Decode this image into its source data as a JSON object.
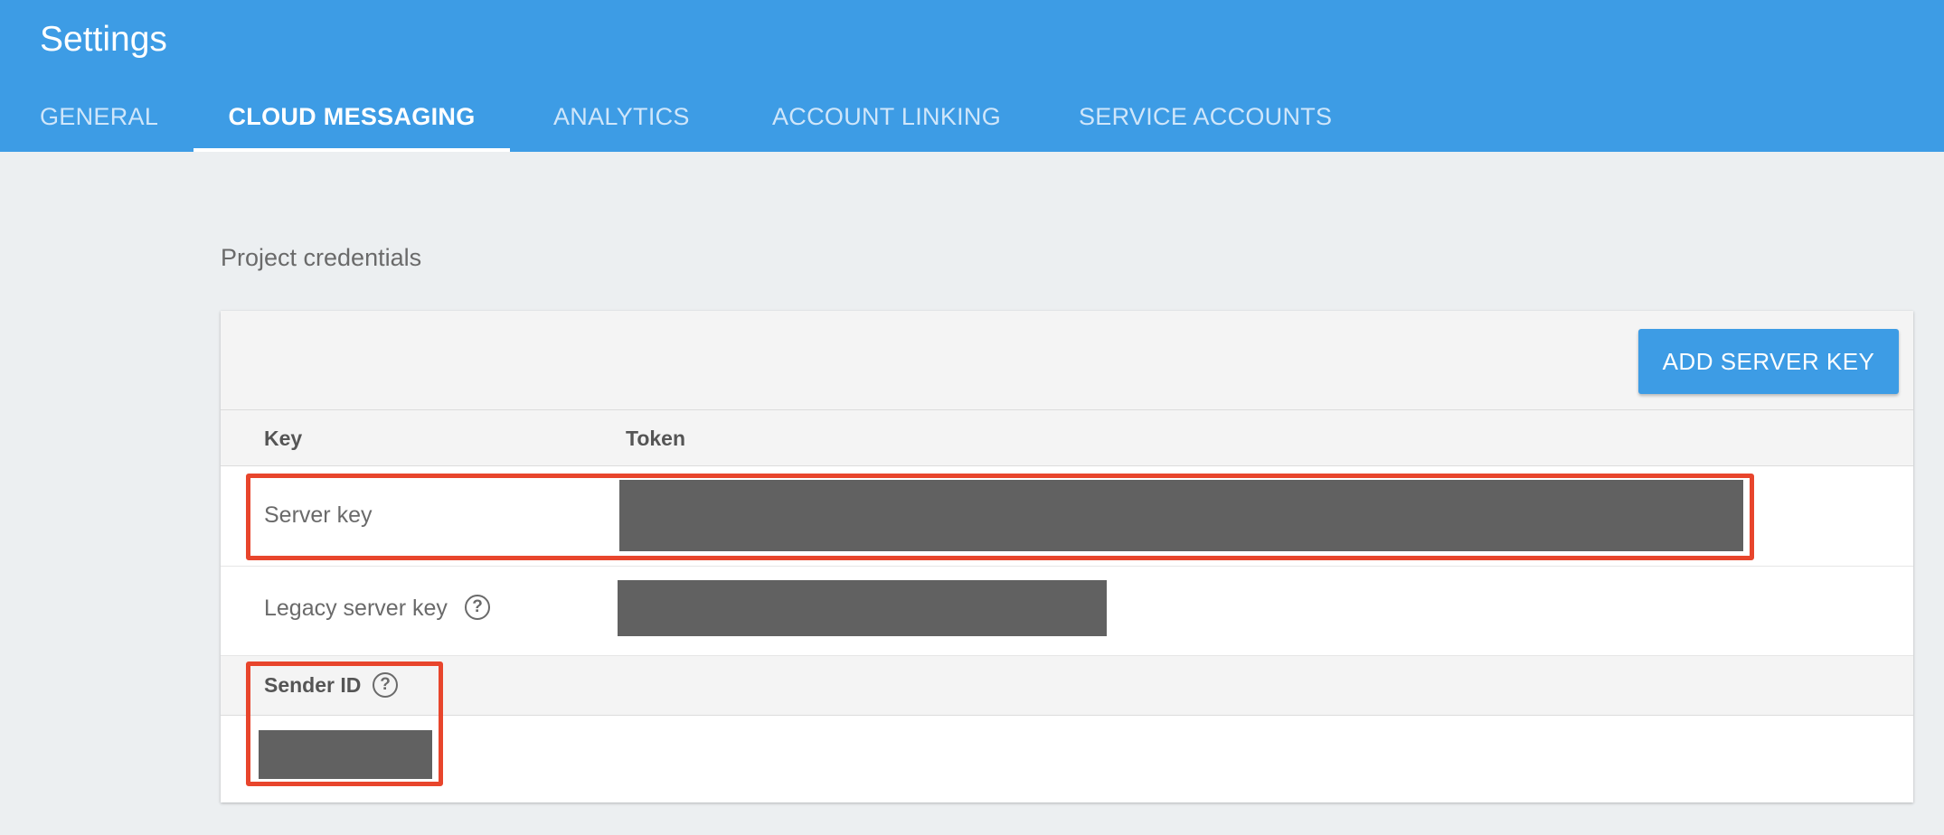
{
  "header": {
    "title": "Settings",
    "tabs": [
      {
        "label": "GENERAL",
        "active": false
      },
      {
        "label": "CLOUD MESSAGING",
        "active": true
      },
      {
        "label": "ANALYTICS",
        "active": false
      },
      {
        "label": "ACCOUNT LINKING",
        "active": false
      },
      {
        "label": "SERVICE ACCOUNTS",
        "active": false
      }
    ]
  },
  "credentials": {
    "section_title": "Project credentials",
    "add_button_label": "ADD SERVER KEY",
    "columns": {
      "key": "Key",
      "token": "Token"
    },
    "rows": [
      {
        "label": "Server key",
        "token": "redacted"
      },
      {
        "label": "Legacy server key",
        "token": "redacted",
        "help_icon": "help-circle-icon"
      }
    ],
    "sender": {
      "label": "Sender ID",
      "help_icon": "help-circle-icon",
      "value": "redacted"
    }
  },
  "colors": {
    "header_bg": "#3d9ce5",
    "page_bg": "#eceff1",
    "highlight": "#e8452c",
    "redaction": "#616161"
  }
}
